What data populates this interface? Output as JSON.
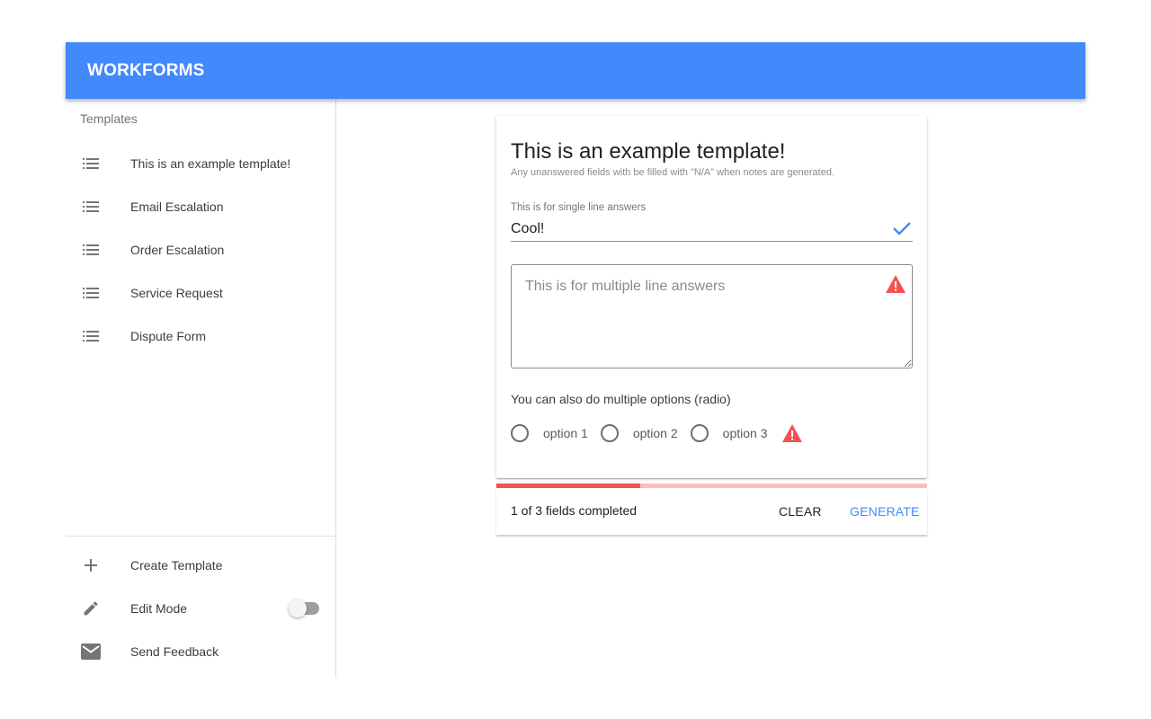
{
  "app": {
    "title": "WORKFORMS",
    "accent_color": "#4389fc",
    "error_color": "#f55151"
  },
  "sidebar": {
    "subheader": "Templates",
    "templates": [
      {
        "label": "This is an example template!",
        "icon": "list-icon"
      },
      {
        "label": "Email Escalation",
        "icon": "list-icon"
      },
      {
        "label": "Order Escalation",
        "icon": "list-icon"
      },
      {
        "label": "Service Request",
        "icon": "list-icon"
      },
      {
        "label": "Dispute Form",
        "icon": "list-icon"
      }
    ],
    "actions": [
      {
        "label": "Create Template",
        "icon": "plus-icon"
      },
      {
        "label": "Edit Mode",
        "icon": "pencil-icon",
        "toggle": false
      },
      {
        "label": "Send Feedback",
        "icon": "mail-icon"
      }
    ]
  },
  "form": {
    "title": "This is an example template!",
    "subtitle": "Any unanswered fields with be filled with \"N/A\" when notes are generated.",
    "single_line": {
      "label": "This is for single line answers",
      "value": "Cool!",
      "status": "valid"
    },
    "multi_line": {
      "placeholder": "This is for multiple line answers",
      "value": "",
      "status": "warning"
    },
    "radio": {
      "question": "You can also do multiple options (radio)",
      "options": [
        "option 1",
        "option 2",
        "option 3"
      ],
      "selected": null,
      "status": "warning"
    }
  },
  "progress": {
    "completed": 1,
    "total": 3,
    "fraction": 0.3333,
    "text": "1 of 3 fields completed"
  },
  "actions": {
    "clear_label": "CLEAR",
    "generate_label": "GENERATE"
  }
}
